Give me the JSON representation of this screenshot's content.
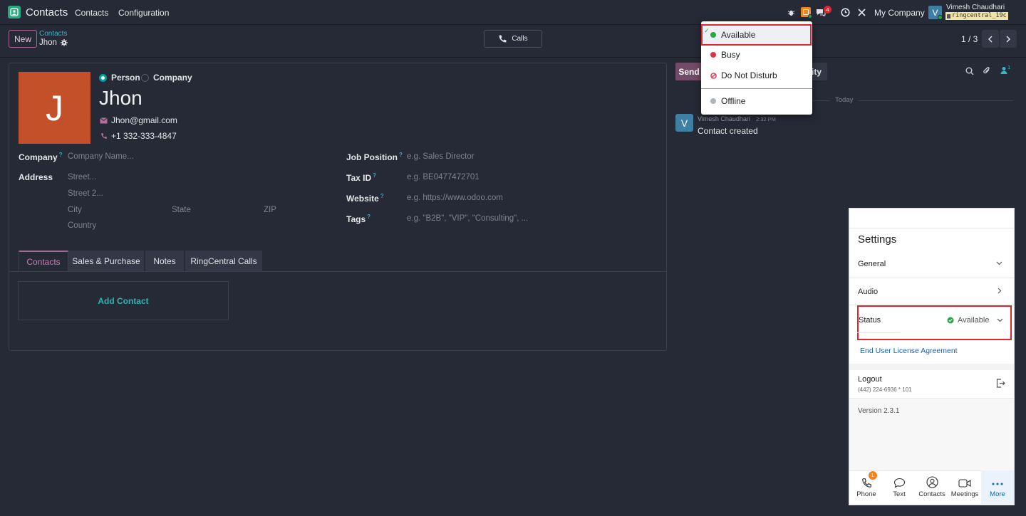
{
  "app": {
    "name": "Contacts"
  },
  "topnav": {
    "menu": [
      "Contacts",
      "Configuration"
    ],
    "chat_badge": "4",
    "company": "My Company",
    "user_initial": "V",
    "user_name": "Vimesh Chaudhari",
    "db_name": "ringcentral_19c"
  },
  "control": {
    "new_label": "New",
    "breadcrumb_parent": "Contacts",
    "breadcrumb_current": "Jhon",
    "calls_label": "Calls",
    "pager": "1 / 3"
  },
  "form": {
    "type_options": [
      "Person",
      "Company"
    ],
    "avatar_letter": "J",
    "name": "Jhon",
    "email": "Jhon@gmail.com",
    "phone": "+1 332-333-4847",
    "company_label": "Company",
    "company_placeholder": "Company Name...",
    "address_label": "Address",
    "street_placeholder": "Street...",
    "street2_placeholder": "Street 2...",
    "city_placeholder": "City",
    "state_placeholder": "State",
    "zip_placeholder": "ZIP",
    "country_placeholder": "Country",
    "job_label": "Job Position",
    "job_placeholder": "e.g. Sales Director",
    "tax_label": "Tax ID",
    "tax_placeholder": "e.g. BE0477472701",
    "website_label": "Website",
    "website_placeholder": "e.g. https://www.odoo.com",
    "tags_label": "Tags",
    "tags_placeholder": "e.g. \"B2B\", \"VIP\", \"Consulting\", ...",
    "help_mark": "?",
    "tabs": [
      "Contacts",
      "Sales & Purchase",
      "Notes",
      "RingCentral Calls"
    ],
    "add_contact": "Add Contact"
  },
  "chatter": {
    "send_label": "Send",
    "activity_label": "ity",
    "follower_count": "1",
    "date_divider": "Today",
    "msg_initial": "V",
    "msg_author": "Vimesh Chaudhari",
    "msg_time": "2:32 PM",
    "msg_body": "Contact created"
  },
  "status_menu": {
    "items": [
      {
        "label": "Available",
        "color": "#28a745"
      },
      {
        "label": "Busy",
        "color": "#dc3545"
      },
      {
        "label": "Do Not Disturb",
        "color": "#dc3545"
      },
      {
        "label": "Offline",
        "color": "#adb5bd"
      }
    ]
  },
  "phone_panel": {
    "title": "Settings",
    "general": "General",
    "audio": "Audio",
    "status_label": "Status",
    "status_value": "Available",
    "eula": "End User License Agreement",
    "logout": "Logout",
    "logout_number": "(442) 224-6936 * 101",
    "version": "Version 2.3.1",
    "phone_badge": "1",
    "bottom_tabs": [
      "Phone",
      "Text",
      "Contacts",
      "Meetings",
      "More"
    ]
  },
  "colors": {
    "accent": "#00a09d",
    "brand": "#714b67",
    "highlight_border": "#e0252f",
    "avatar": "#c4502a",
    "link_blue": "#0a66c2"
  }
}
